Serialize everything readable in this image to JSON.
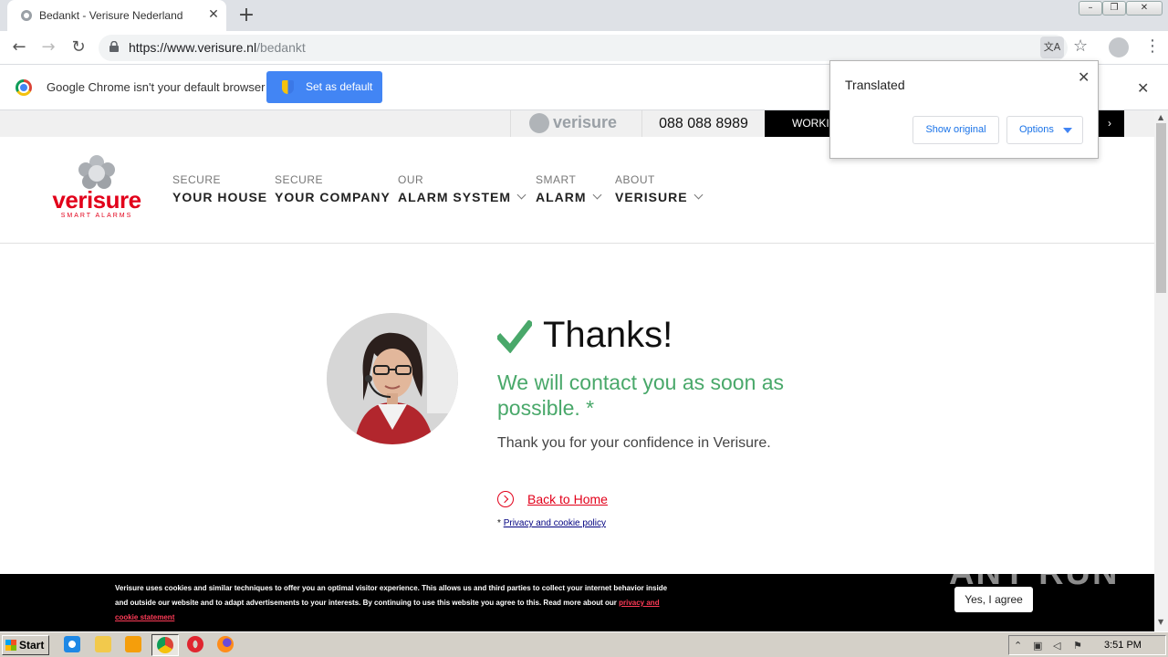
{
  "browser": {
    "tab_title": "Bedankt - Verisure Nederland",
    "url_host": "https://www.verisure.nl",
    "url_path": "/bedankt"
  },
  "infobar": {
    "message": "Google Chrome isn't your default browser",
    "set_default_label": "Set as default"
  },
  "translate_popup": {
    "title": "Translated",
    "show_original_label": "Show original",
    "options_label": "Options"
  },
  "topstrip": {
    "logo_word": "verisure",
    "phone": "088 088 8989",
    "working_label": "WORKI"
  },
  "brand": {
    "word": "verisure",
    "tagline": "SMART ALARMS"
  },
  "nav": [
    {
      "small": "SECURE",
      "big": "YOUR HOUSE"
    },
    {
      "small": "SECURE",
      "big": "YOUR COMPANY"
    },
    {
      "small": "OUR",
      "big": "ALARM SYSTEM"
    },
    {
      "small": "SMART",
      "big": "ALARM"
    },
    {
      "small": "ABOUT",
      "big": "VERISURE"
    }
  ],
  "thanks": {
    "title": "Thanks!",
    "subtitle": "We will contact you as soon as possible. *",
    "body": "Thank you for your confidence in Verisure.",
    "back_home": "Back to Home",
    "privacy_prefix": "*",
    "privacy_link": "Privacy and cookie policy"
  },
  "cookie": {
    "text": "Verisure uses cookies and similar techniques to offer you an optimal visitor experience. This allows us and third parties to collect your internet behavior inside and outside our website and to adapt advertisements to your interests. By continuing to use this website you agree to this. Read more about our",
    "link": "privacy and cookie statement",
    "agree_label": "Yes, I agree"
  },
  "watermark": "ANY RUN",
  "taskbar": {
    "start_label": "Start",
    "clock": "3:51 PM"
  },
  "colors": {
    "brand_red": "#e2001a",
    "success_green": "#49a86a",
    "chrome_blue": "#4285f4"
  }
}
